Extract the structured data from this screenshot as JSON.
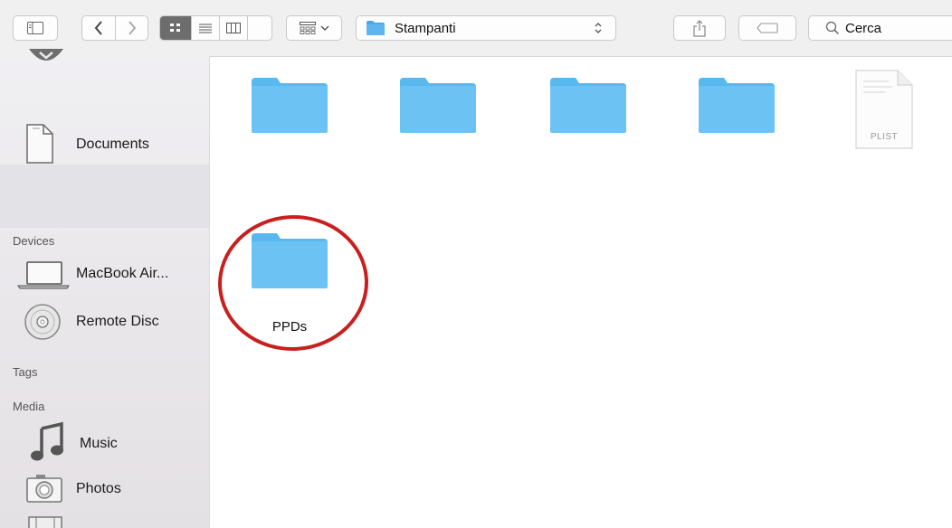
{
  "toolbar": {
    "path": "Stampanti",
    "search_label": "Cerca"
  },
  "sidebar": {
    "sections": {
      "devices": "Devices",
      "tags": "Tags",
      "media": "Media"
    },
    "items": [
      {
        "label": "Documents",
        "icon": "document-icon"
      },
      {
        "label": "MacBook Air...",
        "icon": "laptop-icon"
      },
      {
        "label": "Remote Disc",
        "icon": "disc-icon"
      },
      {
        "label": "Music",
        "icon": "music-note-icon"
      },
      {
        "label": "Photos",
        "icon": "camera-icon"
      }
    ]
  },
  "files": [
    {
      "name": "",
      "type": "folder"
    },
    {
      "name": "",
      "type": "folder"
    },
    {
      "name": "",
      "type": "folder"
    },
    {
      "name": "",
      "type": "folder"
    },
    {
      "name": "",
      "type": "plist",
      "badge": "PLIST"
    },
    {
      "name": "PPDs",
      "type": "folder",
      "highlighted": true
    }
  ],
  "colors": {
    "folder": "#6cc3f3",
    "annotation_circle": "#c8201f"
  }
}
